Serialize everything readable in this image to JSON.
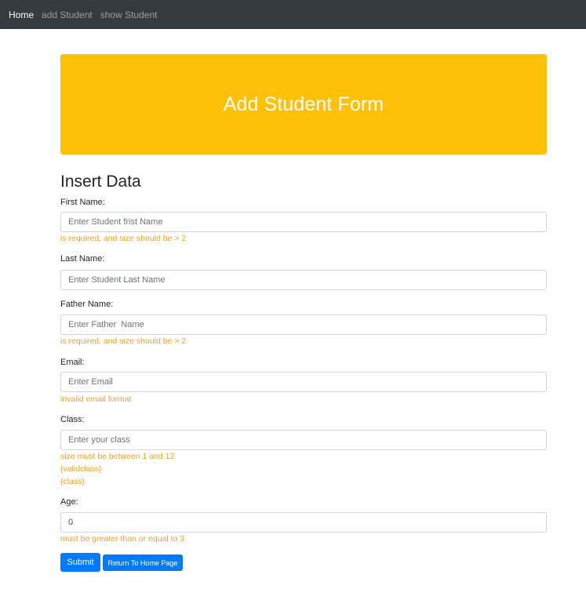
{
  "nav": {
    "items": [
      {
        "label": "Home"
      },
      {
        "label": "add Student"
      },
      {
        "label": "show Student"
      }
    ]
  },
  "header": {
    "title": "Add Student Form"
  },
  "form": {
    "title": "Insert Data",
    "first_name": {
      "label": "First Name:",
      "placeholder": "Enter Student frist Name",
      "value": "",
      "error": "is required, and size should be > 2"
    },
    "last_name": {
      "label": "Last Name:",
      "placeholder": "Enter Student Last Name",
      "value": ""
    },
    "father_name": {
      "label": "Father Name:",
      "placeholder": "Enter Father  Name",
      "value": "",
      "error": "is required, and size should be > 2"
    },
    "email": {
      "label": "Email:",
      "placeholder": "Enter Email",
      "value": "",
      "error": "invalid email format"
    },
    "class": {
      "label": "Class:",
      "placeholder": "Enter your class",
      "value": "",
      "errors": [
        "size must be between 1 and 12",
        "{validclass}",
        "{class}"
      ]
    },
    "age": {
      "label": "Age:",
      "placeholder": "",
      "value": "0",
      "error": "must be greater than or equal to 3"
    },
    "submit_label": "Submit",
    "home_label": "Return To Home Page"
  },
  "colors": {
    "navbar": "#343a40",
    "jumbotron": "#ffc107",
    "error": "#f0a020",
    "primary": "#007bff"
  }
}
